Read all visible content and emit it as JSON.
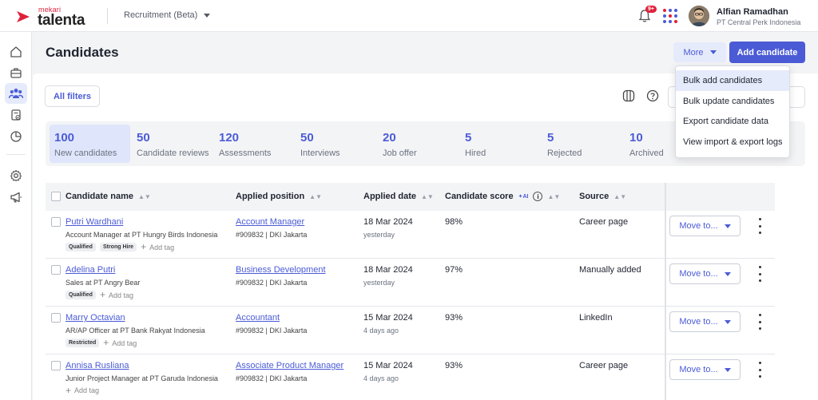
{
  "header": {
    "logo_small": "mekari",
    "logo_big": "talenta",
    "module": "Recruitment (Beta)",
    "notification_badge": "9+",
    "user_name": "Alfian Ramadhan",
    "user_company": "PT Central Perk Indonesia"
  },
  "page": {
    "title": "Candidates",
    "more_label": "More",
    "add_candidate_label": "Add candidate",
    "all_filters_label": "All filters"
  },
  "more_menu": [
    {
      "label": "Bulk add candidates",
      "highlighted": true
    },
    {
      "label": "Bulk update candidates"
    },
    {
      "label": "Export candidate data"
    },
    {
      "label": "View import & export logs"
    }
  ],
  "stages": [
    {
      "count": "100",
      "label": "New candidates",
      "active": true
    },
    {
      "count": "50",
      "label": "Candidate reviews"
    },
    {
      "count": "120",
      "label": "Assessments"
    },
    {
      "count": "50",
      "label": "Interviews"
    },
    {
      "count": "20",
      "label": "Job offer"
    },
    {
      "count": "5",
      "label": "Hired"
    },
    {
      "count": "5",
      "label": "Rejected"
    },
    {
      "count": "10",
      "label": "Archived"
    }
  ],
  "table": {
    "headers": {
      "name": "Candidate name",
      "position": "Applied position",
      "date": "Applied date",
      "score": "Candidate score",
      "ai": "✦AI",
      "source": "Source"
    },
    "move_label": "Move to...",
    "add_tag_label": "Add tag",
    "rows": [
      {
        "name": "Putri Wardhani",
        "sub": "Account Manager at PT Hungry Birds Indonesia",
        "tags": [
          "Qualified",
          "Strong Hire"
        ],
        "position": "Account Manager",
        "position_sub": "#909832 | DKI Jakarta",
        "date": "18 Mar 2024",
        "date_sub": "yesterday",
        "score": "98%",
        "source": "Career page"
      },
      {
        "name": "Adelina Putri",
        "sub": "Sales at PT Angry Bear",
        "tags": [
          "Qualified"
        ],
        "position": "Business Development",
        "position_sub": "#909832 | DKI Jakarta",
        "date": "18 Mar 2024",
        "date_sub": "yesterday",
        "score": "97%",
        "source": "Manually added"
      },
      {
        "name": "Marry Octavian",
        "sub": "AR/AP Officer at PT Bank Rakyat Indonesia",
        "tags": [
          "Restricted"
        ],
        "position": "Accountant",
        "position_sub": "#909832 | DKI Jakarta",
        "date": "15 Mar 2024",
        "date_sub": "4 days ago",
        "score": "93%",
        "source": "LinkedIn"
      },
      {
        "name": "Annisa Rusliana",
        "sub": "Junior Project Manager at PT Garuda Indonesia",
        "tags": [],
        "position": "Associate Product Manager",
        "position_sub": "#909832 | DKI Jakarta",
        "date": "15 Mar 2024",
        "date_sub": "4 days ago",
        "score": "93%",
        "source": "Career page"
      }
    ]
  },
  "colors": {
    "brand": "#e0203b",
    "accent": "#4b5bd6"
  }
}
